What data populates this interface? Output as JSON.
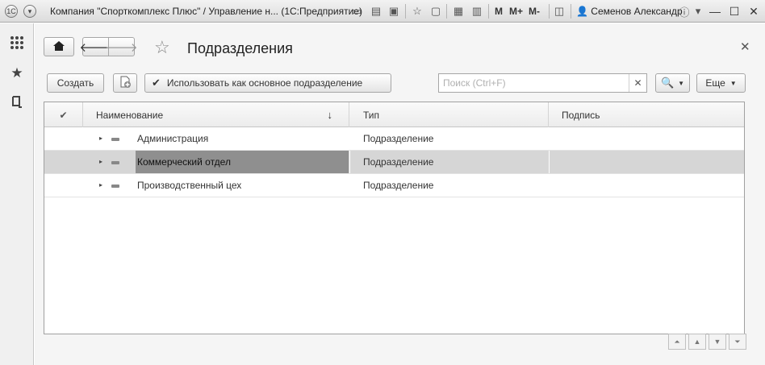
{
  "titlebar": {
    "title": "Компания \"Спорткомплекс Плюс\" / Управление н...  (1С:Предприятие)",
    "m_label": "M",
    "m_plus_label": "M+",
    "m_minus_label": "M-",
    "user": "Семенов Александр"
  },
  "toolbar": {
    "create_label": "Создать",
    "use_main_label": "Использовать как основное подразделение",
    "search_placeholder": "Поиск (Ctrl+F)",
    "more_label": "Еще"
  },
  "form": {
    "title": "Подразделения"
  },
  "table": {
    "columns": {
      "name": "Наименование",
      "type": "Тип",
      "signature": "Подпись"
    },
    "rows": [
      {
        "name": "Администрация",
        "type": "Подразделение",
        "signature": ""
      },
      {
        "name": "Коммерческий отдел",
        "type": "Подразделение",
        "signature": ""
      },
      {
        "name": "Производственный цех",
        "type": "Подразделение",
        "signature": ""
      }
    ]
  }
}
